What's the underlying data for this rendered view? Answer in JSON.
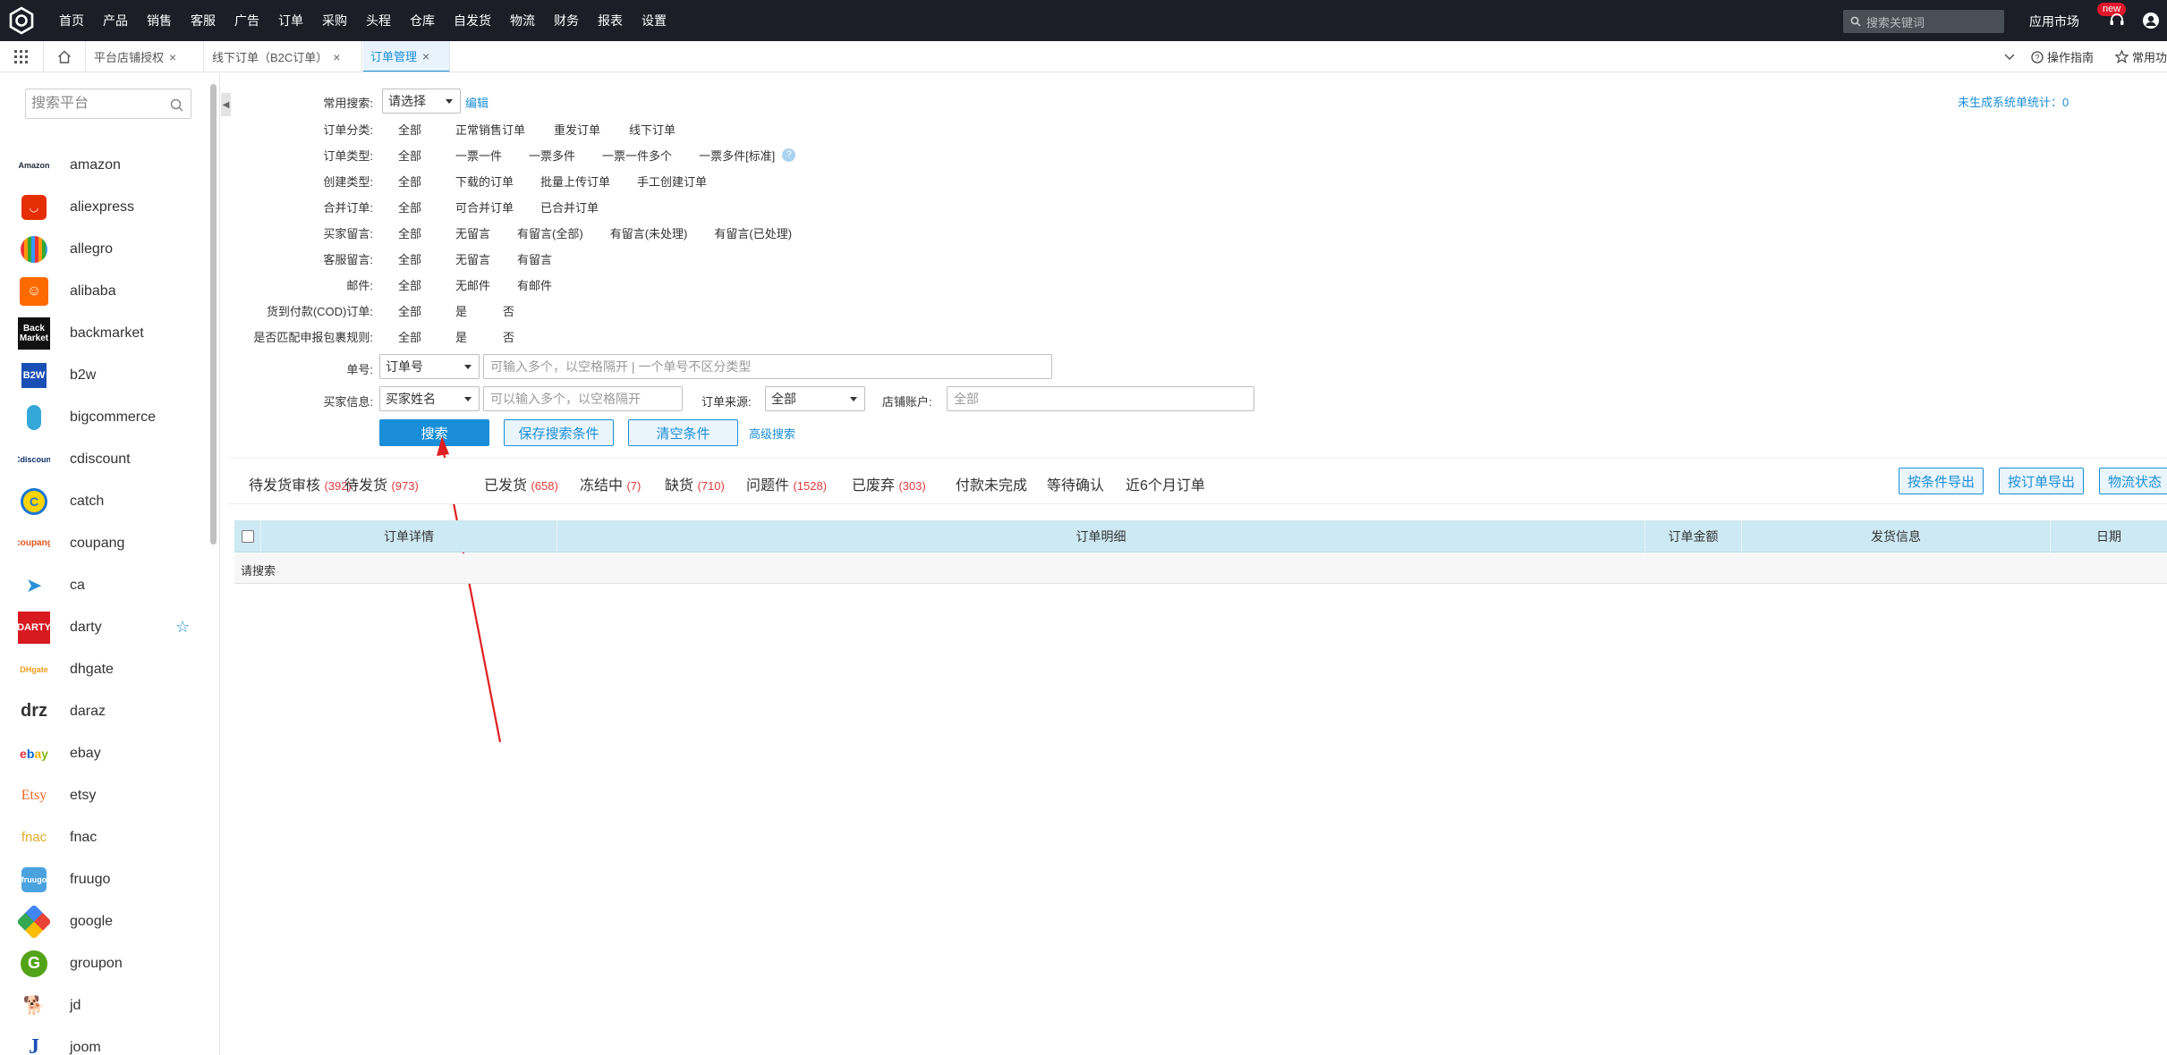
{
  "topnav": {
    "items": [
      "首页",
      "产品",
      "销售",
      "客服",
      "广告",
      "订单",
      "采购",
      "头程",
      "仓库",
      "自发货",
      "物流",
      "财务",
      "报表",
      "设置"
    ],
    "search_placeholder": "搜索关键词",
    "app_market": "应用市场",
    "new_badge": "new"
  },
  "tabbar": {
    "tabs": [
      {
        "label": "平台店铺授权"
      },
      {
        "label": "线下订单（B2C订单）"
      },
      {
        "label": "订单管理"
      }
    ],
    "guide": "操作指南",
    "common": "常用功"
  },
  "sidebar": {
    "search_placeholder": "搜索平台",
    "platforms": [
      {
        "name": "amazon",
        "color": "#232f3e"
      },
      {
        "name": "aliexpress",
        "color": "#e62e04"
      },
      {
        "name": "allegro",
        "color": "#ff5a00"
      },
      {
        "name": "alibaba",
        "color": "#ff6a00"
      },
      {
        "name": "backmarket",
        "color": "#111111"
      },
      {
        "name": "b2w",
        "color": "#1a4fb5"
      },
      {
        "name": "bigcommerce",
        "color": "#34a8d8"
      },
      {
        "name": "cdiscount",
        "color": "#0c2f6b"
      },
      {
        "name": "catch",
        "color": "#1976d2"
      },
      {
        "name": "coupang",
        "color": "#e0541f"
      },
      {
        "name": "ca",
        "color": "#2a8fd6"
      },
      {
        "name": "darty",
        "color": "#d71920"
      },
      {
        "name": "dhgate",
        "color": "#f29b1b"
      },
      {
        "name": "daraz",
        "color": "#333333"
      },
      {
        "name": "ebay",
        "color": "#0064d2"
      },
      {
        "name": "etsy",
        "color": "#f1641e"
      },
      {
        "name": "fnac",
        "color": "#e1a925"
      },
      {
        "name": "fruugo",
        "color": "#4aa3df"
      },
      {
        "name": "google",
        "color": "#4285f4"
      },
      {
        "name": "groupon",
        "color": "#53a318"
      },
      {
        "name": "jd",
        "color": "#999999"
      },
      {
        "name": "joom",
        "color": "#1c4fb6"
      }
    ]
  },
  "filters": {
    "common_search": {
      "label": "常用搜索:",
      "select": "请选择",
      "edit": "编辑"
    },
    "unsynced_stat": "未生成系统单统计：0",
    "rows": [
      {
        "label": "订单分类:",
        "options": [
          "全部",
          "正常销售订单",
          "重发订单",
          "线下订单"
        ]
      },
      {
        "label": "订单类型:",
        "options": [
          "全部",
          "一票一件",
          "一票多件",
          "一票一件多个",
          "一票多件[标准]"
        ]
      },
      {
        "label": "创建类型:",
        "options": [
          "全部",
          "下载的订单",
          "批量上传订单",
          "手工创建订单"
        ]
      },
      {
        "label": "合并订单:",
        "options": [
          "全部",
          "可合并订单",
          "已合并订单"
        ]
      },
      {
        "label": "买家留言:",
        "options": [
          "全部",
          "无留言",
          "有留言(全部)",
          "有留言(未处理)",
          "有留言(已处理)"
        ]
      },
      {
        "label": "客服留言:",
        "options": [
          "全部",
          "无留言",
          "有留言"
        ]
      },
      {
        "label": "邮件:",
        "options": [
          "全部",
          "无邮件",
          "有邮件"
        ]
      },
      {
        "label": "货到付款(COD)订单:",
        "options": [
          "全部",
          "是",
          "否"
        ]
      },
      {
        "label": "是否匹配申报包裹规则:",
        "options": [
          "全部",
          "是",
          "否"
        ]
      }
    ],
    "order_no": {
      "label": "单号:",
      "select": "订单号",
      "placeholder": "可输入多个，以空格隔开 | 一个单号不区分类型"
    },
    "buyer": {
      "label": "买家信息:",
      "select": "买家姓名",
      "placeholder": "可以输入多个，以空格隔开"
    },
    "source": {
      "label": "订单来源:",
      "select": "全部"
    },
    "store": {
      "label": "店铺账户:",
      "placeholder": "全部"
    },
    "buttons": {
      "search": "搜索",
      "save": "保存搜索条件",
      "clear": "清空条件",
      "advanced": "高级搜索"
    }
  },
  "status_tabs": [
    {
      "label": "待发货审核",
      "count": "(392)"
    },
    {
      "label": "待发货",
      "count": "(973)"
    },
    {
      "label": "已发货",
      "count": "(658)"
    },
    {
      "label": "冻结中",
      "count": "(7)"
    },
    {
      "label": "缺货",
      "count": "(710)"
    },
    {
      "label": "问题件",
      "count": "(1528)"
    },
    {
      "label": "已废弃",
      "count": "(303)"
    },
    {
      "label": "付款未完成",
      "count": ""
    },
    {
      "label": "等待确认",
      "count": ""
    },
    {
      "label": "近6个月订单",
      "count": ""
    }
  ],
  "export": {
    "by_condition": "按条件导出",
    "by_order": "按订单导出",
    "logistics": "物流状态"
  },
  "table": {
    "headers": [
      "订单详情",
      "订单明细",
      "订单金额",
      "发货信息",
      "日期"
    ],
    "empty_text": "请搜索"
  }
}
